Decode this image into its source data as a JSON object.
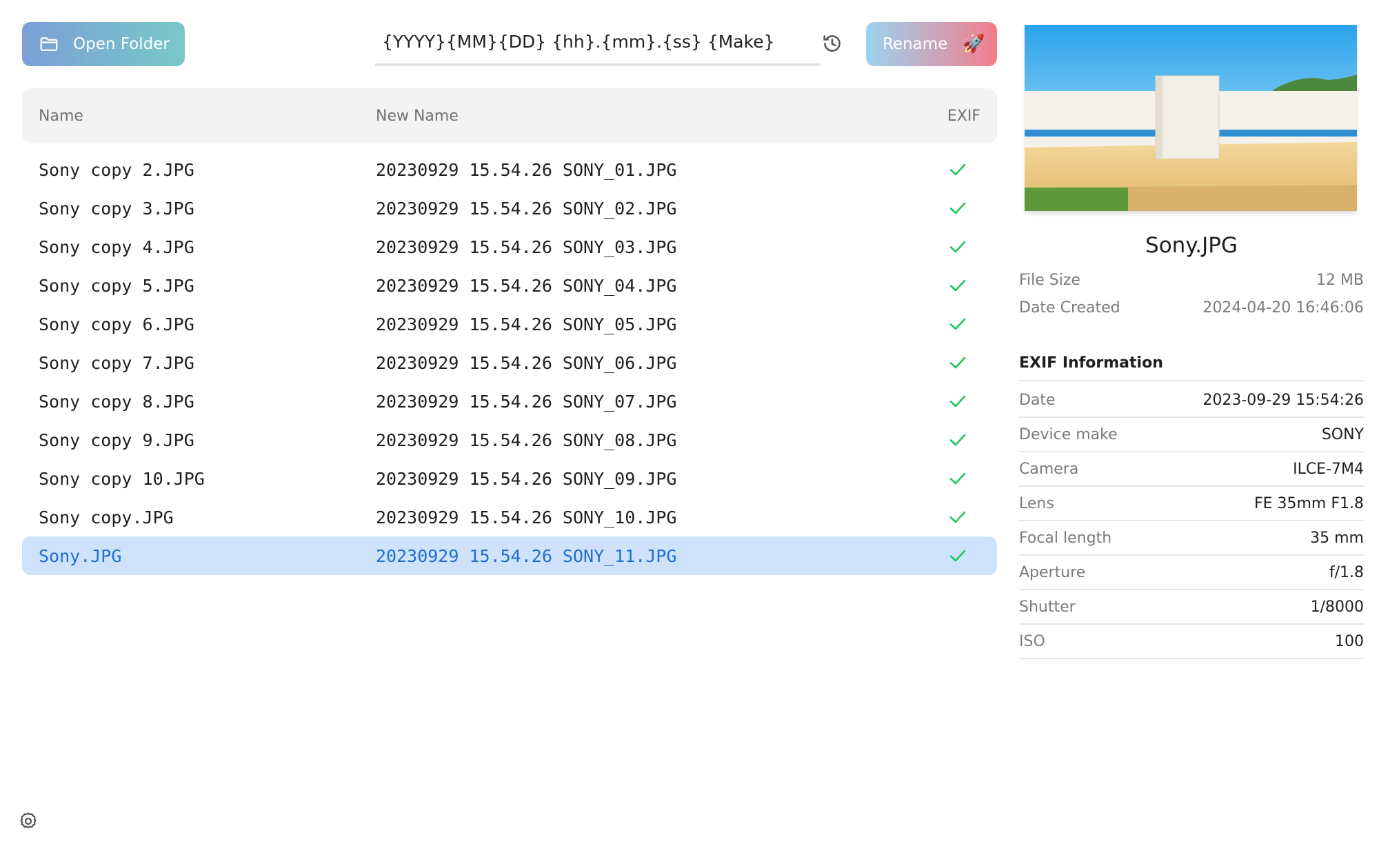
{
  "toolbar": {
    "open_folder_label": "Open Folder",
    "pattern_value": "{YYYY}{MM}{DD} {hh}.{mm}.{ss} {Make}",
    "rename_label": "Rename",
    "rename_icon": "🚀",
    "history_icon": "history-clock-icon"
  },
  "table": {
    "headers": {
      "name": "Name",
      "new_name": "New Name",
      "exif": "EXIF"
    },
    "rows": [
      {
        "name": "Sony copy 2.JPG",
        "new_name": "20230929 15.54.26 SONY_01.JPG"
      },
      {
        "name": "Sony copy 3.JPG",
        "new_name": "20230929 15.54.26 SONY_02.JPG"
      },
      {
        "name": "Sony copy 4.JPG",
        "new_name": "20230929 15.54.26 SONY_03.JPG"
      },
      {
        "name": "Sony copy 5.JPG",
        "new_name": "20230929 15.54.26 SONY_04.JPG"
      },
      {
        "name": "Sony copy 6.JPG",
        "new_name": "20230929 15.54.26 SONY_05.JPG"
      },
      {
        "name": "Sony copy 7.JPG",
        "new_name": "20230929 15.54.26 SONY_06.JPG"
      },
      {
        "name": "Sony copy 8.JPG",
        "new_name": "20230929 15.54.26 SONY_07.JPG"
      },
      {
        "name": "Sony copy 9.JPG",
        "new_name": "20230929 15.54.26 SONY_08.JPG"
      },
      {
        "name": "Sony copy 10.JPG",
        "new_name": "20230929 15.54.26 SONY_09.JPG"
      },
      {
        "name": "Sony copy.JPG",
        "new_name": "20230929 15.54.26 SONY_10.JPG"
      },
      {
        "name": "Sony.JPG",
        "new_name": "20230929 15.54.26 SONY_11.JPG"
      }
    ]
  },
  "panel": {
    "file_name": "Sony.JPG",
    "file_size_label": "File Size",
    "file_size_value": "12 MB",
    "date_created_label": "Date Created",
    "date_created_value": "2024-04-20 16:46:06",
    "exif_heading": "EXIF Information",
    "exif": [
      {
        "k": "Date",
        "v": "2023-09-29 15:54:26"
      },
      {
        "k": "Device make",
        "v": "SONY"
      },
      {
        "k": "Camera",
        "v": "ILCE-7M4"
      },
      {
        "k": "Lens",
        "v": "FE 35mm F1.8"
      },
      {
        "k": "Focal length",
        "v": "35 mm"
      },
      {
        "k": "Aperture",
        "v": "f/1.8"
      },
      {
        "k": "Shutter",
        "v": "1/8000"
      },
      {
        "k": "ISO",
        "v": "100"
      }
    ]
  },
  "colors": {
    "check": "#22c55e",
    "selected_bg": "#cfe2fb",
    "selected_text": "#1e6fd0"
  }
}
